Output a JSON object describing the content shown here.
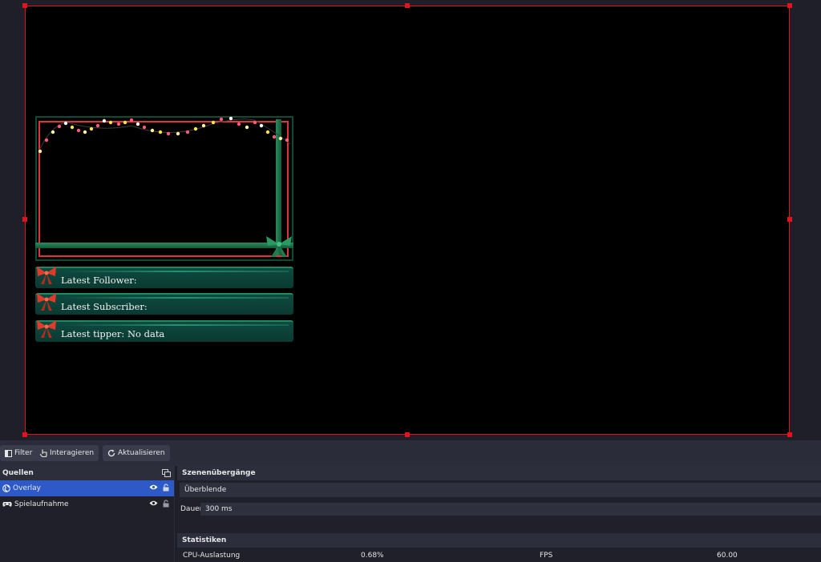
{
  "overlay": {
    "alerts": [
      {
        "label": "Latest Follower:"
      },
      {
        "label": "Latest Subscriber:"
      },
      {
        "label": "Latest tipper: No data"
      }
    ]
  },
  "toolbar": {
    "filter_label": "Filter",
    "interact_label": "Interagieren",
    "refresh_label": "Aktualisieren"
  },
  "sources": {
    "title": "Quellen",
    "items": [
      {
        "name": "Overlay",
        "icon": "globe-icon",
        "selected": true
      },
      {
        "name": "Spielaufnahme",
        "icon": "gamepad-icon",
        "selected": false
      }
    ]
  },
  "transitions": {
    "title": "Szenenübergänge",
    "selected": "Überblende",
    "duration_label": "Dauer",
    "duration_value": "300 ms"
  },
  "stats": {
    "title": "Statistiken",
    "cpu_label": "CPU-Auslastung",
    "cpu_value": "0.68%",
    "fps_label": "FPS",
    "fps_value": "60.00"
  },
  "colors": {
    "selection_border": "#e0141a",
    "selected_row": "#2e5ac8",
    "ribbon_green": "#0f5c3a",
    "frame_red": "#e0343a"
  }
}
